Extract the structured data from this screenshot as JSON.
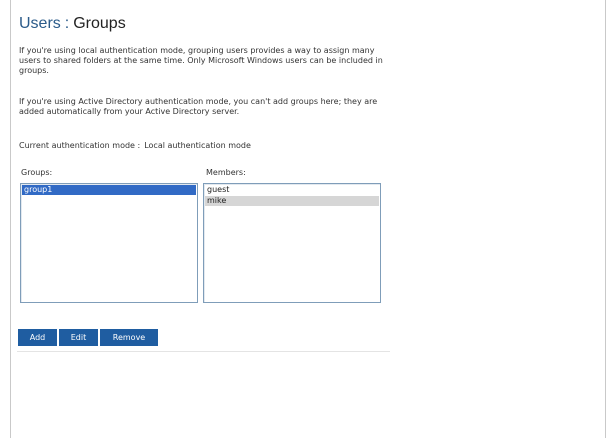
{
  "header": {
    "section": "Users",
    "separator": ":",
    "page": "Groups"
  },
  "intro": {
    "local_mode_text": "If you're using local authentication mode, grouping users provides a way to assign many users to shared folders at the same time. Only Microsoft Windows users can be included in groups.",
    "ad_mode_text": "If you're using Active Directory authentication mode, you can't add groups here; they are added automatically from your Active Directory server."
  },
  "auth": {
    "label": "Current authentication mode :",
    "value": "Local authentication mode"
  },
  "groups": {
    "label": "Groups:",
    "items": [
      "group1"
    ],
    "selected": "group1"
  },
  "members": {
    "label": "Members:",
    "items": [
      "guest",
      "mike"
    ],
    "selected": "mike"
  },
  "buttons": {
    "add": "Add",
    "edit": "Edit",
    "remove": "Remove"
  },
  "colors": {
    "accent": "#1f5da1",
    "title_section": "#2b5b8a",
    "selection_active": "#316ac5",
    "selection_inactive": "#d6d6d6",
    "list_border": "#7f9db9"
  }
}
